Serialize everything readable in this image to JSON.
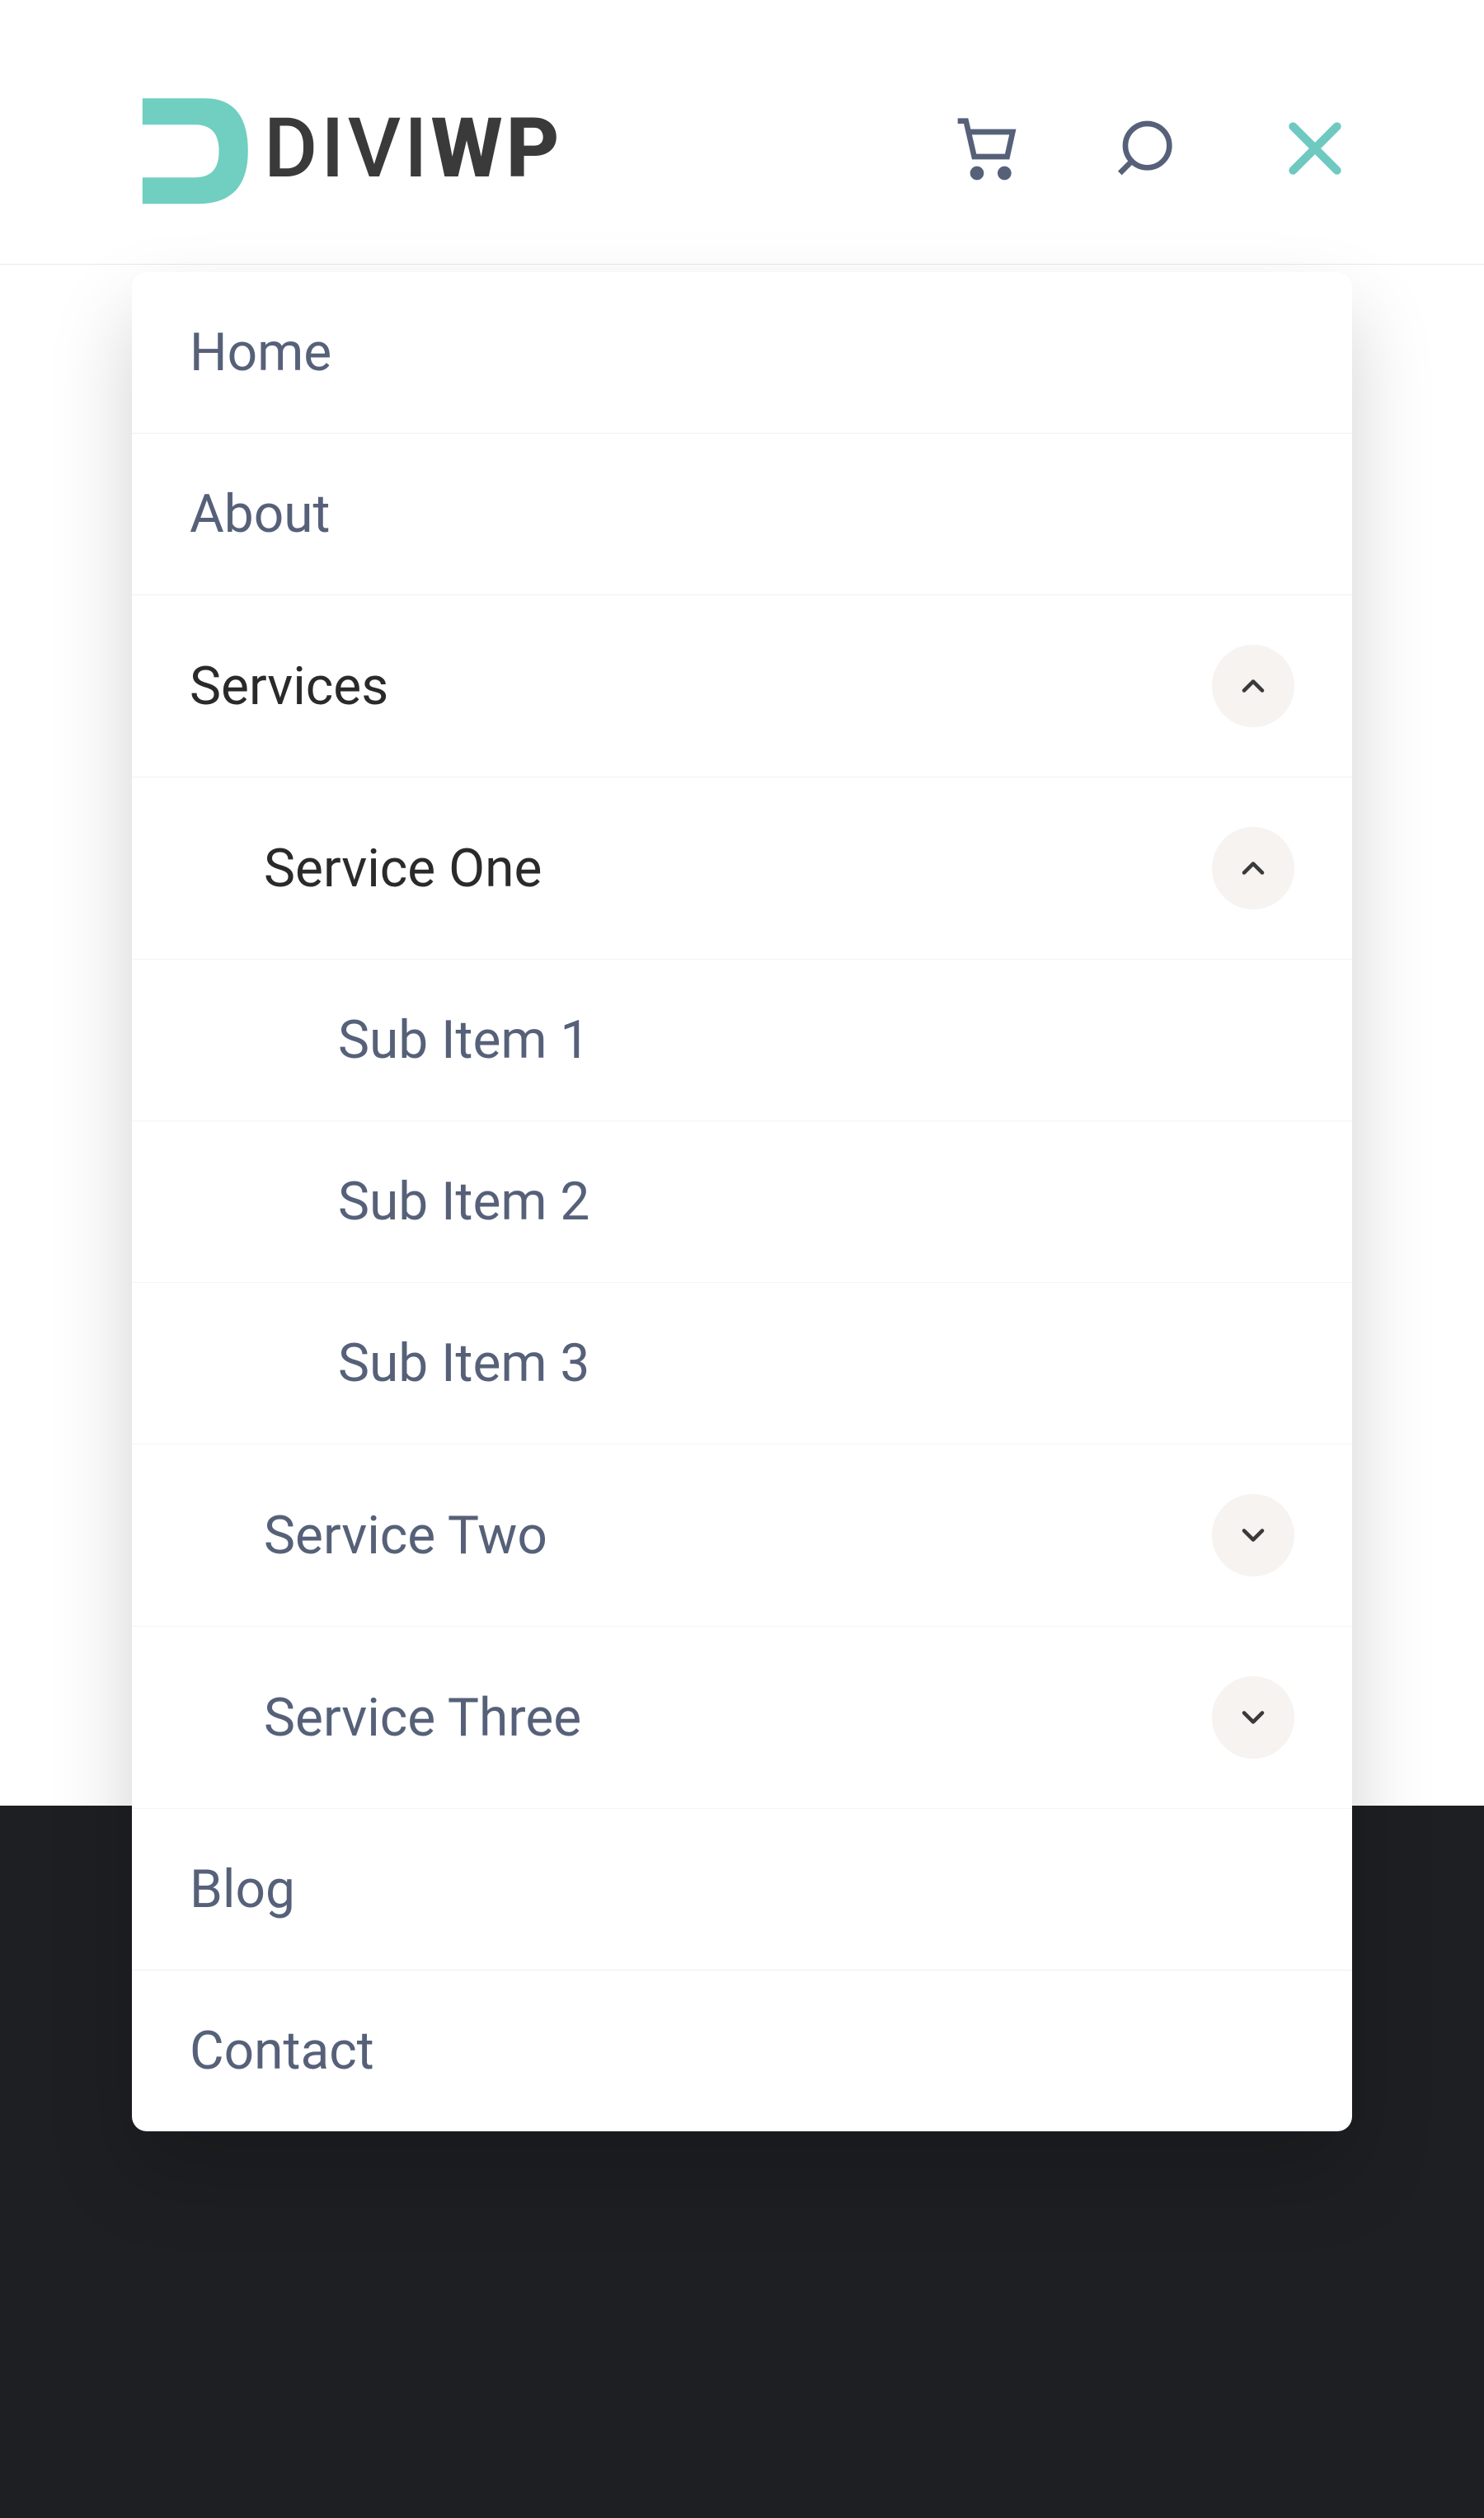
{
  "logo": {
    "text_thin": "DIVI",
    "text_bold": "WP"
  },
  "header_icons": {
    "cart": "cart",
    "search": "search",
    "close": "close"
  },
  "menu": {
    "home": "Home",
    "about": "About",
    "services": "Services",
    "service_one": "Service One",
    "sub1": "Sub Item 1",
    "sub2": "Sub Item 2",
    "sub3": "Sub Item 3",
    "service_two": "Service Two",
    "service_three": "Service Three",
    "blog": "Blog",
    "contact": "Contact"
  }
}
